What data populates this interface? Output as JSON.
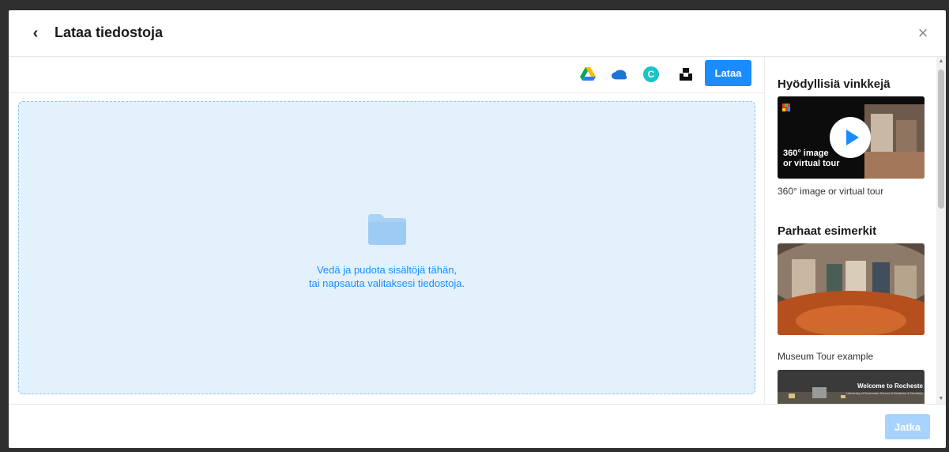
{
  "header": {
    "back_glyph": "‹",
    "title": "Lataa tiedostoja",
    "close_glyph": "×"
  },
  "toolbar": {
    "sources": [
      {
        "name": "google-drive-icon"
      },
      {
        "name": "onedrive-icon"
      },
      {
        "name": "canva-icon",
        "letter": "C"
      },
      {
        "name": "unsplash-icon"
      }
    ],
    "upload_label": "Lataa"
  },
  "dropzone": {
    "line1": "Vedä ja pudota sisältöjä tähän,",
    "line2": "tai napsauta valitaksesi tiedostoja."
  },
  "sidebar": {
    "tips_heading": "Hyödyllisiä vinkkejä",
    "tip_video": {
      "overlay_line1": "360° image",
      "overlay_line2": "or virtual tour",
      "caption": "360° image or virtual tour"
    },
    "examples_heading": "Parhaat esimerkit",
    "example1_caption": "Museum Tour example",
    "example2_overlay_title": "Welcome to Rocheste",
    "example2_overlay_sub": "University of Rochester School of Medicine & Dentistry"
  },
  "footer": {
    "continue_label": "Jatka"
  },
  "colors": {
    "accent": "#1a8cff",
    "accent_disabled": "#a6d3ff",
    "dropzone_bg": "#e3f1fd"
  }
}
